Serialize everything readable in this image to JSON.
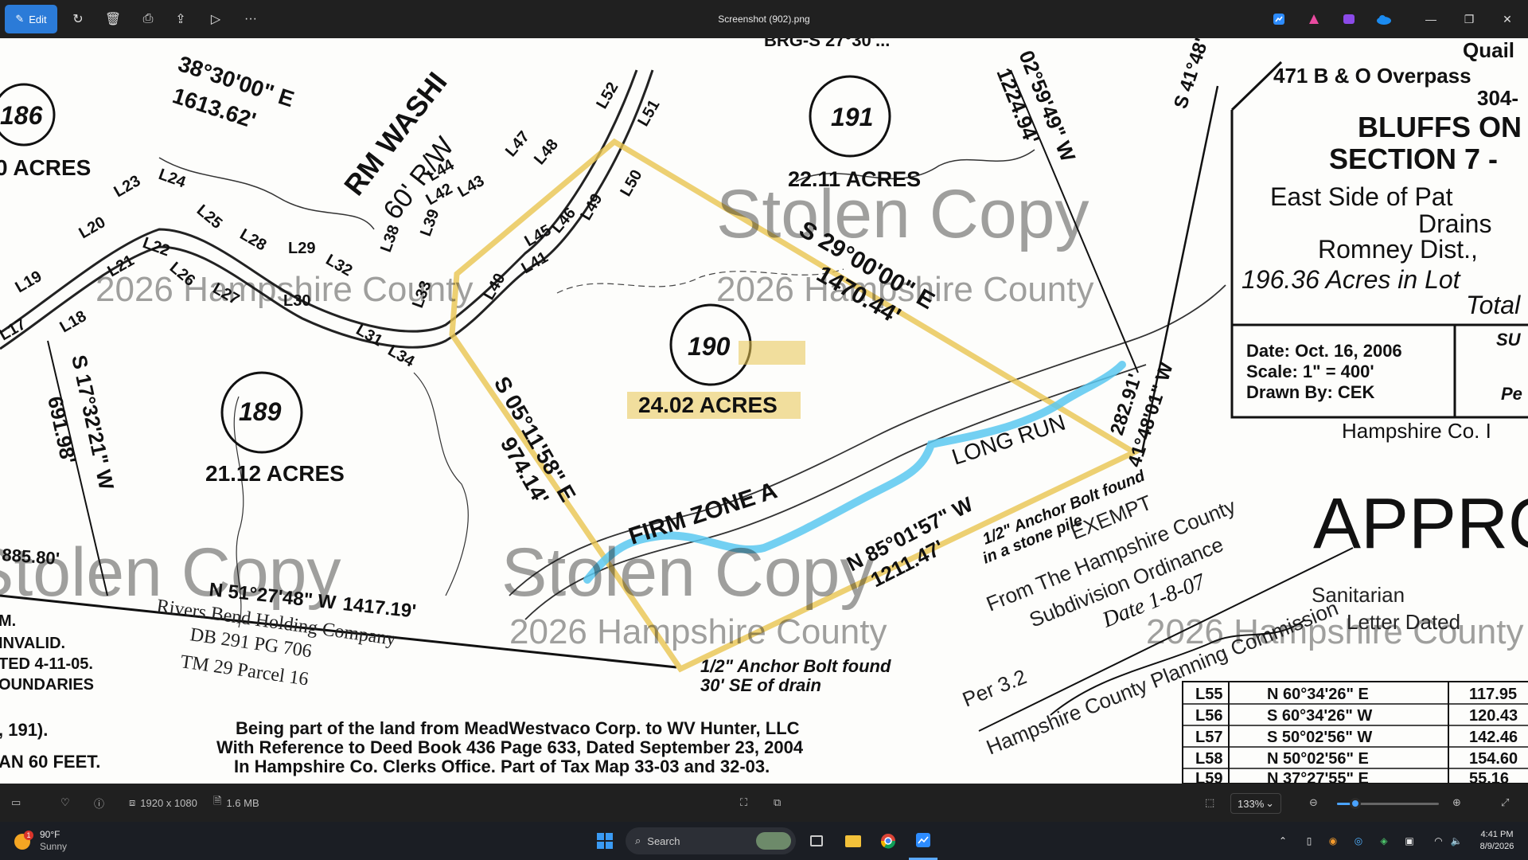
{
  "titlebar": {
    "edit_label": "Edit",
    "title": "Screenshot (902).png"
  },
  "map": {
    "parcel_186": "186",
    "acres_186": "0 ACRES",
    "parcel_191": "191",
    "acres_191": "22.11 ACRES",
    "parcel_190": "190",
    "acres_190": "24.02 ACRES",
    "parcel_189": "189",
    "acres_189": "21.12 ACRES",
    "bearing_top_left": "38°30'00\" E",
    "dist_top_left": "1613.62'",
    "road_name": "RM WASHI",
    "road_row": "60' R/W",
    "brg_top": "BRG-S 27°30'...",
    "bearing_right_top": "02°59'49\" W",
    "dist_right_top": "1224.94'",
    "bearing_s41": "S 41°48'",
    "bearing_ne": "S 29°00'00\" E",
    "dist_ne": "1470.44'",
    "bearing_w": "S 05°11'58\" E",
    "dist_w": "974.14'",
    "bearing_s": "N 85°01'57\" W",
    "dist_s": "1211.47'",
    "bearing_e": "41°48'01\" W",
    "dist_e": "282.91'",
    "bearing_bottom": "N 51°27'48\" W",
    "dist_bottom": "1417.19'",
    "dist_885": "885.80'",
    "bearing_left": "S 17°32'21\" W",
    "dist_left": "691.98'",
    "long_run": "LONG RUN",
    "firm_zone": "FIRM ZONE A",
    "anchor_bolt_stone": "1/2\" Anchor Bolt found",
    "in_stone_pile": "in a stone pile",
    "anchor_bolt_drain_1": "1/2\" Anchor Bolt found",
    "anchor_bolt_drain_2": "30' SE of drain",
    "rivers_bend_1": "Rivers Bend Holding Company",
    "rivers_bend_2": "DB 291 PG 706",
    "rivers_bend_3": "TM 29 Parcel 16",
    "invalid_1": "INVALID.",
    "invalid_2": "TED 4-11-05.",
    "invalid_3": "OUNDARIES",
    "note_191": ", 191).",
    "note_60": "AN 60 FEET.",
    "m_label": "M.",
    "deed_1": "Being part of the land from MeadWestvaco Corp. to WV Hunter, LLC",
    "deed_2": "With Reference to Deed Book 436 Page 633, Dated September 23, 2004",
    "deed_3": "In Hampshire Co. Clerks Office. Part of Tax Map 33-03 and 32-03.",
    "exempt_1": "EXEMPT",
    "exempt_2": "From The Hampshire County",
    "exempt_3": "Subdivision Ordinance",
    "exempt_4": "Per 3.2",
    "exempt_date": "Date 1-8-07",
    "planning": "Hampshire County Planning Commission",
    "sanitarian": "Sanitarian",
    "letter_dated": "Letter Dated",
    "approved": "APPRO",
    "tb_quail": "Quail",
    "tb_road": "471 B & O Overpass",
    "tb_phone": "304-",
    "tb_bluffs": "BLUFFS ON",
    "tb_section": "SECTION 7 -",
    "tb_east": "East Side of Pat",
    "tb_drains": "Drains",
    "tb_romney": "Romney Dist.,",
    "tb_acres": "196.36 Acres in Lot",
    "tb_total": "Total",
    "tb_date": "Date: Oct. 16, 2006",
    "tb_scale": "Scale: 1\" = 400'",
    "tb_drawn": "Drawn By: CEK",
    "tb_su": "SU",
    "tb_pe": "Pe",
    "hampshire_co": "Hampshire Co. I",
    "watermark_big": "Stolen Copy",
    "watermark_small": "2026 Hampshire County",
    "lines": [
      "L17",
      "L18",
      "L19",
      "L20",
      "L21",
      "L22",
      "L23",
      "L24",
      "L25",
      "L26",
      "L27",
      "L28",
      "L29",
      "L30",
      "L31",
      "L32",
      "L33",
      "L34",
      "L38",
      "L39",
      "L40",
      "L41",
      "L42",
      "L43",
      "L44",
      "L45",
      "L46",
      "L47",
      "L48",
      "L49",
      "L50",
      "L51",
      "L52"
    ],
    "table_rows": [
      {
        "line": "L55",
        "bearing": "N 60°34'26\" E",
        "dist": "117.95"
      },
      {
        "line": "L56",
        "bearing": "S 60°34'26\" W",
        "dist": "120.43"
      },
      {
        "line": "L57",
        "bearing": "S 50°02'56\" W",
        "dist": "142.46"
      },
      {
        "line": "L58",
        "bearing": "N 50°02'56\" E",
        "dist": "154.60"
      },
      {
        "line": "L59",
        "bearing": "N 37°27'55\" E",
        "dist": "55.16"
      }
    ]
  },
  "bottombar": {
    "dimensions": "1920 x 1080",
    "filesize": "1.6 MB",
    "zoom": "133%",
    "zoom_level": 0.18
  },
  "taskbar": {
    "weather_temp": "90°F",
    "weather_cond": "Sunny",
    "weather_badge": "1",
    "search_placeholder": "Search",
    "time": "4:41 PM",
    "date": "8/9/2026"
  },
  "colors": {
    "accent": "#2b7bd8",
    "highlight_yellow": "#e8c450",
    "highlight_blue": "#5bc8f0"
  }
}
